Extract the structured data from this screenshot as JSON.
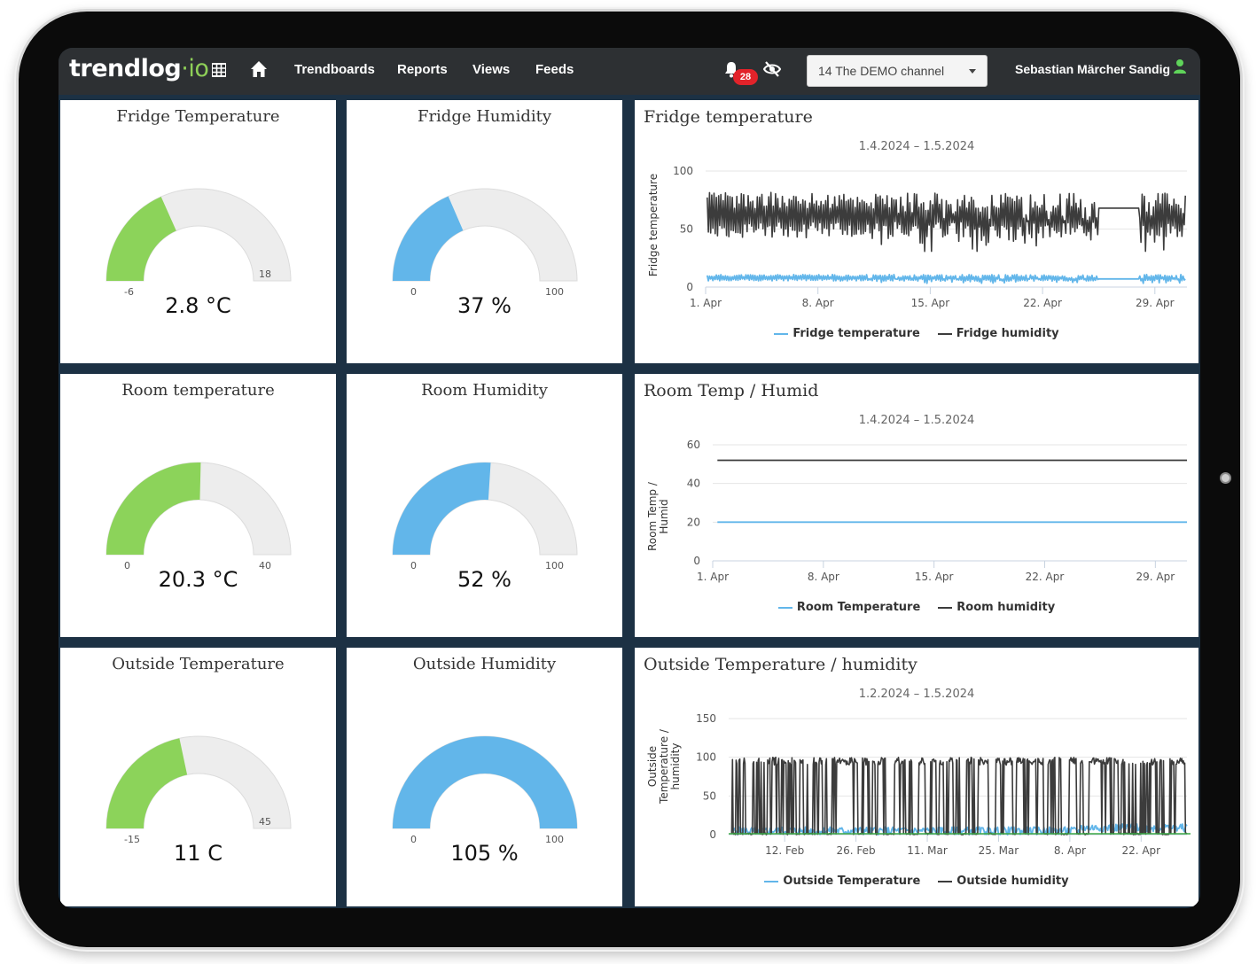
{
  "topbar": {
    "logo_main": "trendlog",
    "logo_sep": "·",
    "logo_suffix": "io",
    "nav": [
      "Trendboards",
      "Reports",
      "Views",
      "Feeds"
    ],
    "notification_count": "28",
    "channel_select": "14 The DEMO channel",
    "user_name": "Sebastian Märcher Sandig",
    "icons": [
      "grid-icon",
      "home-icon",
      "bell-icon",
      "eye-off-icon",
      "user-icon"
    ]
  },
  "colors": {
    "green": "#8cd35a",
    "blue": "#62b6ea",
    "track": "#ededed",
    "dark_series": "#3c3c3c",
    "topbar": "#2d3033"
  },
  "gauges": [
    {
      "title": "Fridge Temperature",
      "value": "2.8 °C",
      "min": "-6",
      "max": "18",
      "min_num": -6,
      "max_num": 18,
      "num": 2.8,
      "color": "green"
    },
    {
      "title": "Fridge Humidity",
      "value": "37 %",
      "min": "0",
      "max": "100",
      "min_num": 0,
      "max_num": 100,
      "num": 37,
      "color": "blue"
    },
    {
      "title": "Room temperature",
      "value": "20.3 °C",
      "min": "0",
      "max": "40",
      "min_num": 0,
      "max_num": 40,
      "num": 20.3,
      "color": "green"
    },
    {
      "title": "Room Humidity",
      "value": "52 %",
      "min": "0",
      "max": "100",
      "min_num": 0,
      "max_num": 100,
      "num": 52,
      "color": "blue"
    },
    {
      "title": "Outside Temperature",
      "value": "11 C",
      "min": "-15",
      "max": "45",
      "min_num": -15,
      "max_num": 45,
      "num": 11,
      "color": "green"
    },
    {
      "title": "Outside Humidity",
      "value": "105 %",
      "min": "0",
      "max": "100",
      "min_num": 0,
      "max_num": 100,
      "num": 105,
      "color": "blue"
    }
  ],
  "charts": [
    {
      "title": "Fridge temperature",
      "subtitle": "1.4.2024 – 1.5.2024",
      "ylabel": "Fridge temperature",
      "legend": [
        "Fridge temperature",
        "Fridge humidity"
      ]
    },
    {
      "title": "Room Temp / Humid",
      "subtitle": "1.4.2024 – 1.5.2024",
      "ylabel": "Room Temp / Humid",
      "legend": [
        "Room Temperature",
        "Room humidity"
      ]
    },
    {
      "title": "Outside Temperature / humidity",
      "subtitle": "1.2.2024 – 1.5.2024",
      "ylabel": "Outside Temperature / humidity",
      "legend": [
        "Outside Temperature",
        "Outside humidity"
      ]
    }
  ],
  "chart_data": [
    {
      "type": "line",
      "title": "Fridge temperature",
      "subtitle": "1.4.2024 – 1.5.2024",
      "ylabel": "Fridge temperature",
      "ylim": [
        0,
        100
      ],
      "yticks": [
        0,
        50,
        100
      ],
      "x_range": [
        1,
        31
      ],
      "xticks": [
        {
          "label": "1. Apr",
          "x": 1
        },
        {
          "label": "8. Apr",
          "x": 8
        },
        {
          "label": "15. Apr",
          "x": 15
        },
        {
          "label": "22. Apr",
          "x": 22
        },
        {
          "label": "29. Apr",
          "x": 29
        }
      ],
      "series": [
        {
          "name": "Fridge temperature",
          "color": "#62b6ea",
          "base": 8,
          "amp": 2,
          "dip": 2
        },
        {
          "name": "Fridge humidity",
          "color": "#3c3c3c",
          "base": 62,
          "amp": 14,
          "dip": 12
        }
      ]
    },
    {
      "type": "line",
      "title": "Room Temp / Humid",
      "subtitle": "1.4.2024 – 1.5.2024",
      "ylabel": "Room Temp / Humid",
      "ylim": [
        0,
        60
      ],
      "yticks": [
        0,
        20,
        40,
        60
      ],
      "x_range": [
        1,
        31
      ],
      "xticks": [
        {
          "label": "1. Apr",
          "x": 1
        },
        {
          "label": "8. Apr",
          "x": 8
        },
        {
          "label": "15. Apr",
          "x": 15
        },
        {
          "label": "22. Apr",
          "x": 22
        },
        {
          "label": "29. Apr",
          "x": 29
        }
      ],
      "series": [
        {
          "name": "Room Temperature",
          "color": "#62b6ea",
          "values": [
            20,
            20
          ]
        },
        {
          "name": "Room humidity",
          "color": "#3c3c3c",
          "values": [
            52,
            52
          ]
        }
      ]
    },
    {
      "type": "line",
      "title": "Outside Temperature / humidity",
      "subtitle": "1.2.2024 – 1.5.2024",
      "ylabel": "Outside Temperature / humidity",
      "ylim": [
        0,
        150
      ],
      "yticks": [
        0,
        50,
        100,
        150
      ],
      "x_range": [
        1,
        91
      ],
      "xticks": [
        {
          "label": "12. Feb",
          "x": 12
        },
        {
          "label": "26. Feb",
          "x": 26
        },
        {
          "label": "11. Mar",
          "x": 40
        },
        {
          "label": "25. Mar",
          "x": 54
        },
        {
          "label": "8. Apr",
          "x": 68
        },
        {
          "label": "22. Apr",
          "x": 82
        }
      ],
      "series": [
        {
          "name": "Outside Temperature",
          "color": "#62b6ea",
          "base": 5,
          "amp": 5
        },
        {
          "name": "Outside humidity",
          "color": "#3c3c3c",
          "high": 100,
          "low": 0
        }
      ]
    }
  ]
}
